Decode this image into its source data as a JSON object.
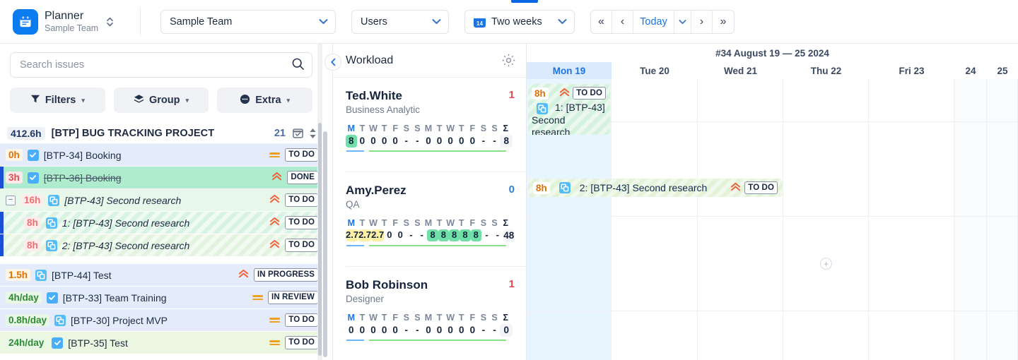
{
  "topbar": {
    "brand_title": "Planner",
    "brand_subtitle": "Sample Team",
    "brand_icon": "calendar-app-icon",
    "team_select": "Sample Team",
    "users_select": "Users",
    "range_select": "Two weeks",
    "range_icon_day": "14",
    "nav": {
      "first": "«",
      "prev": "‹",
      "today": "Today",
      "today_caret": "⌄",
      "next": "›",
      "last": "»"
    }
  },
  "sidebar": {
    "search_placeholder": "Search issues",
    "search_value": "",
    "buttons": [
      {
        "label": "Filters",
        "icon": "filter-icon"
      },
      {
        "label": "Group",
        "icon": "layers-icon"
      },
      {
        "label": "Extra",
        "icon": "ellipsis-icon"
      }
    ],
    "project": {
      "hours": "412.6h",
      "title": "[BTP] BUG TRACKING PROJECT",
      "count": "21"
    },
    "rows": [
      {
        "hours": "0h",
        "hours_style": "h-blue",
        "type": "task",
        "title": "[BTP-34] Booking",
        "priority": "medium",
        "status": "TO DO",
        "bg": "blue",
        "indent": false,
        "strike": false,
        "italic": false,
        "expander": false,
        "leftbar": false,
        "striped": false
      },
      {
        "hours": "3h",
        "hours_style": "h-red",
        "type": "task",
        "title": "[BTP-36] Booking",
        "priority": "high",
        "status": "DONE",
        "bg": "green",
        "indent": false,
        "strike": true,
        "italic": false,
        "expander": false,
        "leftbar": true,
        "striped": false
      },
      {
        "hours": "16h",
        "hours_style": "h-pink",
        "type": "subtask",
        "title": "[BTP-43] Second research",
        "priority": "high",
        "status": "TO DO",
        "bg": "lgreen",
        "indent": false,
        "strike": false,
        "italic": true,
        "expander": true,
        "leftbar": false,
        "striped": false
      },
      {
        "hours": "8h",
        "hours_style": "h-pink",
        "type": "subtask",
        "title": "1: [BTP-43] Second research",
        "priority": "high",
        "status": "TO DO",
        "bg": "sub1",
        "indent": true,
        "strike": false,
        "italic": true,
        "expander": false,
        "leftbar": true,
        "striped": true
      },
      {
        "hours": "8h",
        "hours_style": "h-pink",
        "type": "subtask",
        "title": "2: [BTP-43] Second research",
        "priority": "high",
        "status": "TO DO",
        "bg": "sub2",
        "indent": true,
        "strike": false,
        "italic": true,
        "expander": false,
        "leftbar": true,
        "striped": true
      },
      {
        "spacer": true
      },
      {
        "hours": "1.5h",
        "hours_style": "h-blue",
        "type": "subtask",
        "title": "[BTP-44] Test",
        "priority": "high",
        "status": "IN PROGRESS",
        "bg": "blue",
        "indent": false,
        "strike": false,
        "italic": false,
        "expander": false,
        "leftbar": false,
        "striped": false
      },
      {
        "hours": "4h/day",
        "hours_style": "h-green",
        "type": "task",
        "title": "[BTP-33] Team Training",
        "priority": "medium",
        "status": "IN REVIEW",
        "bg": "blue",
        "indent": false,
        "strike": false,
        "italic": false,
        "expander": false,
        "leftbar": false,
        "striped": false
      },
      {
        "hours": "0.8h/day",
        "hours_style": "h-green",
        "type": "subtask",
        "title": "[BTP-30] Project MVP",
        "priority": "medium",
        "status": "TO DO",
        "bg": "blue",
        "indent": false,
        "strike": false,
        "italic": false,
        "expander": false,
        "leftbar": false,
        "striped": false
      },
      {
        "hours": "24h/day",
        "hours_style": "h-green",
        "type": "task",
        "title": "[BTP-35] Test",
        "priority": "medium",
        "status": "TO DO",
        "bg": "pgreen",
        "indent": false,
        "strike": false,
        "italic": false,
        "expander": false,
        "leftbar": false,
        "striped": false
      }
    ]
  },
  "workload": {
    "title": "Workload",
    "gear_icon": "gear-icon",
    "collapse_icon": "chevron-left-icon",
    "day_letters": [
      "M",
      "T",
      "W",
      "T",
      "F",
      "S",
      "S",
      "M",
      "T",
      "W",
      "T",
      "F",
      "S",
      "S"
    ],
    "sigma": "Σ",
    "people": [
      {
        "name": "Ted.White",
        "role": "Business Analytic",
        "count": "1",
        "count_color": "red",
        "values": [
          "8",
          "0",
          "0",
          "0",
          "0",
          "-",
          "-",
          "0",
          "0",
          "0",
          "0",
          "0",
          "-",
          "-"
        ],
        "highlights": [
          "gr",
          "",
          "",
          "",
          "",
          "",
          "",
          "",
          "",
          "",
          "",
          "",
          "",
          ""
        ],
        "total": "8"
      },
      {
        "name": "Amy.Perez",
        "role": "QA",
        "count": "0",
        "count_color": "blue",
        "values": [
          "2.7",
          "2.7",
          "2.7",
          "0",
          "0",
          "-",
          "-",
          "8",
          "8",
          "8",
          "8",
          "8",
          "-",
          "-"
        ],
        "highlights": [
          "yl",
          "yl",
          "yl",
          "",
          "",
          "",
          "",
          "gr",
          "gr",
          "gr",
          "gr",
          "gr",
          "",
          ""
        ],
        "total": "48"
      },
      {
        "name": "Bob Robinson",
        "role": "Designer",
        "count": "1",
        "count_color": "red",
        "values": [
          "0",
          "0",
          "0",
          "0",
          "0",
          "-",
          "-",
          "0",
          "0",
          "0",
          "0",
          "0",
          "-",
          "-"
        ],
        "highlights": [
          "",
          "",
          "",
          "",
          "",
          "",
          "",
          "",
          "",
          "",
          "",
          "",
          "",
          ""
        ],
        "total": "0"
      }
    ]
  },
  "calendar": {
    "week_title": "#34 August 19 — 25 2024",
    "days": [
      {
        "label": "Mon 19",
        "today": true,
        "weekend": false
      },
      {
        "label": "Tue 20",
        "today": false,
        "weekend": false
      },
      {
        "label": "Wed 21",
        "today": false,
        "weekend": false
      },
      {
        "label": "Thu 22",
        "today": false,
        "weekend": false
      },
      {
        "label": "Fri 23",
        "today": false,
        "weekend": false
      },
      {
        "label": "24",
        "today": false,
        "weekend": true
      },
      {
        "label": "25",
        "today": false,
        "weekend": true
      }
    ],
    "events": [
      {
        "hours": "8h",
        "status": "TO DO",
        "priority": "high",
        "type": "subtask",
        "title": "1: [BTP-43]",
        "title2": "Second research",
        "layout": "card"
      },
      {
        "hours": "8h",
        "status": "TO DO",
        "priority": "high",
        "type": "subtask",
        "title": "2: [BTP-43] Second research",
        "layout": "bar"
      }
    ],
    "add_hint": "+"
  }
}
